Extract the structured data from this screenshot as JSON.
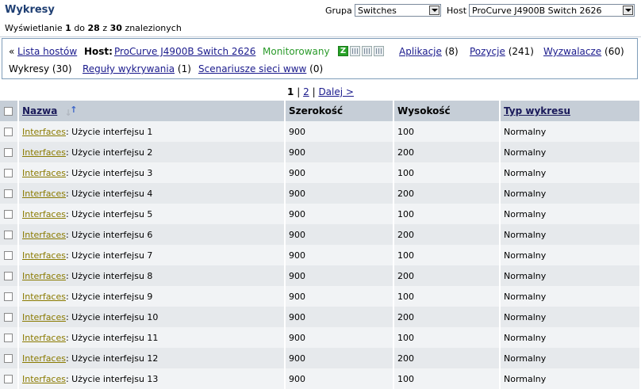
{
  "header": {
    "title": "Wykresy",
    "found_prefix": "Wyświetlanie",
    "found_from": "1",
    "found_to_word": "do",
    "found_to": "28",
    "found_of_word": "z",
    "found_total": "30",
    "found_suffix": "znalezionych",
    "group_label": "Grupa",
    "group_value": "Switches",
    "host_label": "Host",
    "host_value": "ProCurve J4900B Switch 2626"
  },
  "nav": {
    "back_arrow": "«",
    "hosts_list": "Lista hostów",
    "host_label": "Host:",
    "host_name": "ProCurve J4900B Switch 2626",
    "status": "Monitorowany",
    "icons": [
      "zabbix-z-icon",
      "grid-icon",
      "graph-icon",
      "graph-icon-2"
    ],
    "z_glyph": "Z",
    "apps_label": "Aplikacje",
    "apps_count": "(8)",
    "items_label": "Pozycje",
    "items_count": "(241)",
    "triggers_label": "Wyzwalacze",
    "triggers_count": "(60)",
    "graphs_label": "Wykresy (30)",
    "discovery_label": "Reguły wykrywania",
    "discovery_count": "(1)",
    "web_label": "Scenariusze sieci www",
    "web_count": "(0)"
  },
  "pager": {
    "current": "1",
    "separator": "|",
    "page2": "2",
    "next": "Dalej >"
  },
  "table": {
    "headers": {
      "name": "Nazwa",
      "width": "Szerokość",
      "height": "Wysokość",
      "type": "Typ wykresu"
    },
    "rows": [
      {
        "prefix": "Interfaces",
        "name": ": Użycie interfejsu 1",
        "width": "900",
        "height": "100",
        "type": "Normalny"
      },
      {
        "prefix": "Interfaces",
        "name": ": Użycie interfejsu 2",
        "width": "900",
        "height": "200",
        "type": "Normalny"
      },
      {
        "prefix": "Interfaces",
        "name": ": Użycie interfejsu 3",
        "width": "900",
        "height": "100",
        "type": "Normalny"
      },
      {
        "prefix": "Interfaces",
        "name": ": Użycie interfejsu 4",
        "width": "900",
        "height": "200",
        "type": "Normalny"
      },
      {
        "prefix": "Interfaces",
        "name": ": Użycie interfejsu 5",
        "width": "900",
        "height": "100",
        "type": "Normalny"
      },
      {
        "prefix": "Interfaces",
        "name": ": Użycie interfejsu 6",
        "width": "900",
        "height": "200",
        "type": "Normalny"
      },
      {
        "prefix": "Interfaces",
        "name": ": Użycie interfejsu 7",
        "width": "900",
        "height": "100",
        "type": "Normalny"
      },
      {
        "prefix": "Interfaces",
        "name": ": Użycie interfejsu 8",
        "width": "900",
        "height": "200",
        "type": "Normalny"
      },
      {
        "prefix": "Interfaces",
        "name": ": Użycie interfejsu 9",
        "width": "900",
        "height": "100",
        "type": "Normalny"
      },
      {
        "prefix": "Interfaces",
        "name": ": Użycie interfejsu 10",
        "width": "900",
        "height": "200",
        "type": "Normalny"
      },
      {
        "prefix": "Interfaces",
        "name": ": Użycie interfejsu 11",
        "width": "900",
        "height": "100",
        "type": "Normalny"
      },
      {
        "prefix": "Interfaces",
        "name": ": Użycie interfejsu 12",
        "width": "900",
        "height": "200",
        "type": "Normalny"
      },
      {
        "prefix": "Interfaces",
        "name": ": Użycie interfejsu 13",
        "width": "900",
        "height": "100",
        "type": "Normalny"
      }
    ]
  }
}
